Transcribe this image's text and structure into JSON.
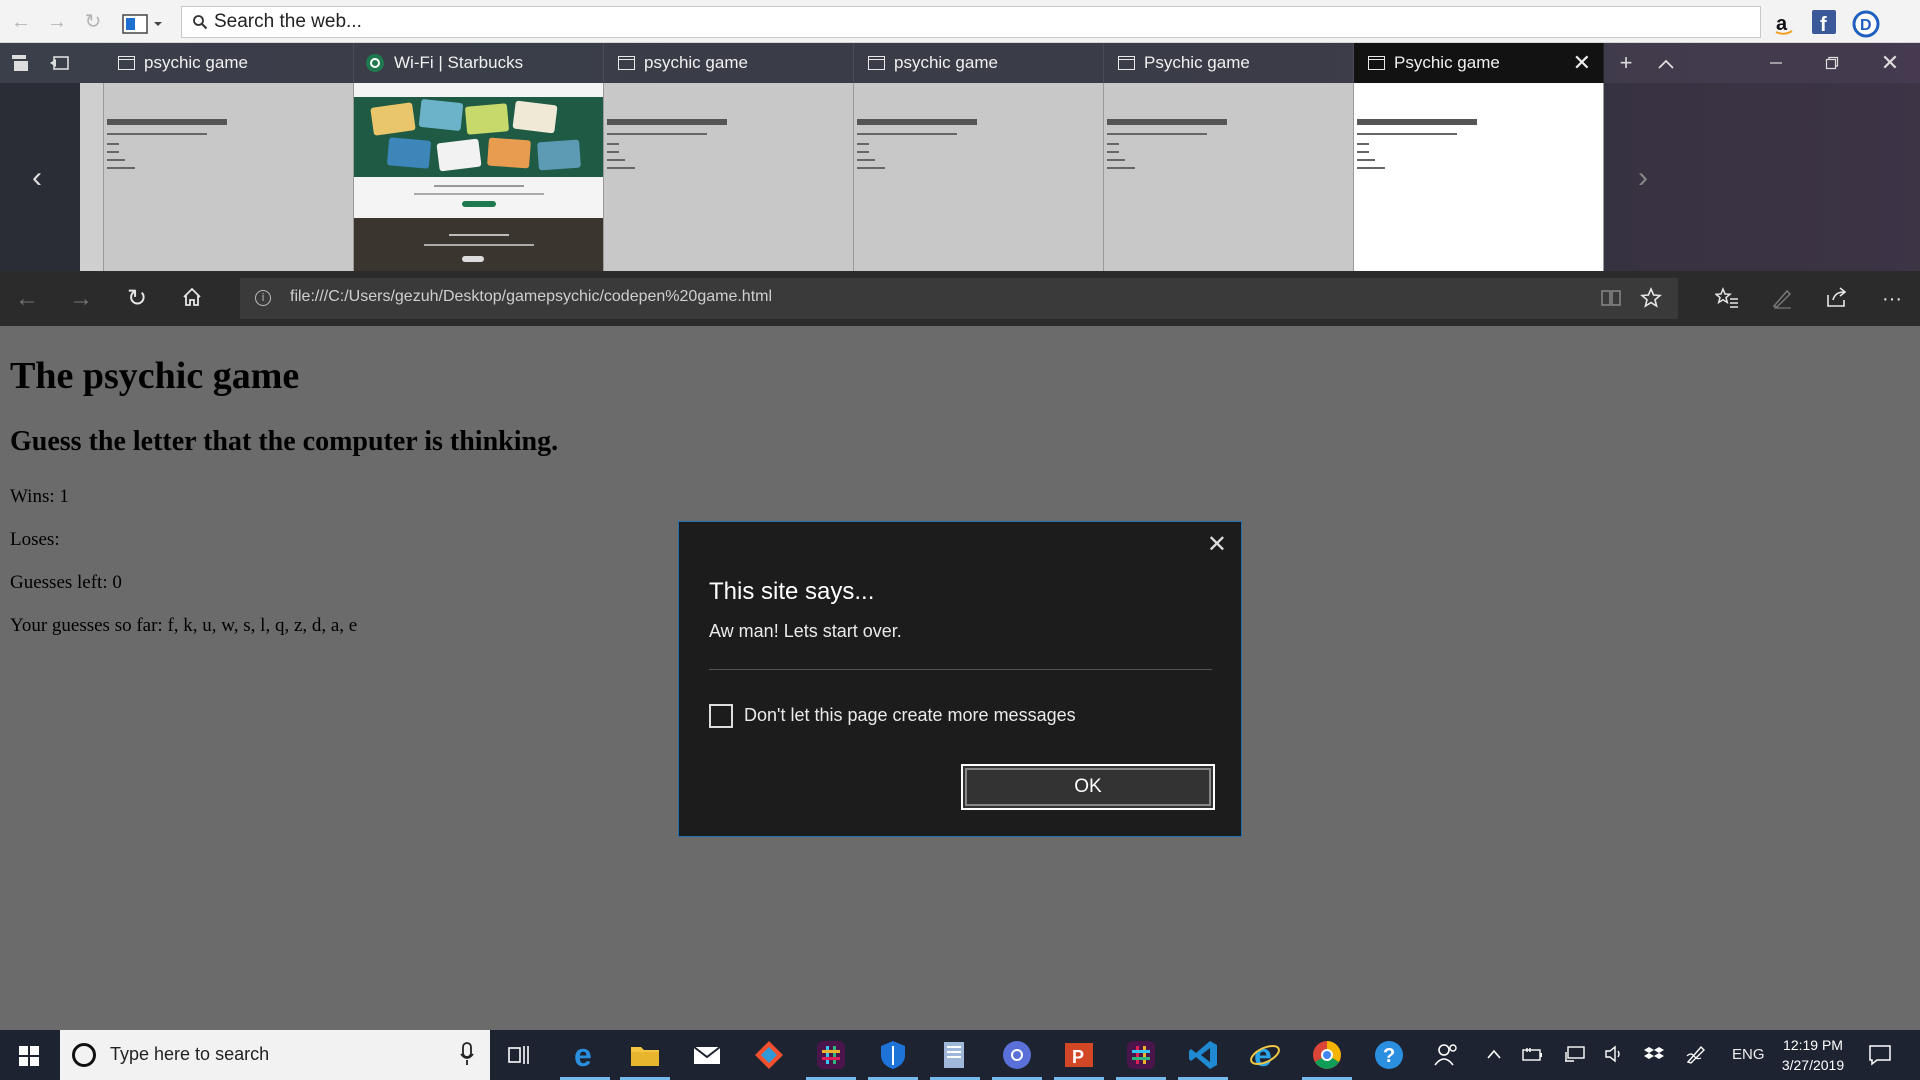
{
  "browser_toolbar": {
    "search_placeholder": "Search the web..."
  },
  "tabs": [
    {
      "label": "psychic game",
      "active": false,
      "icon": "page-icon"
    },
    {
      "label": "Wi-Fi | Starbucks",
      "active": false,
      "icon": "starbucks-icon"
    },
    {
      "label": "psychic game",
      "active": false,
      "icon": "page-icon"
    },
    {
      "label": "psychic game",
      "active": false,
      "icon": "page-icon"
    },
    {
      "label": "Psychic game",
      "active": false,
      "icon": "page-icon"
    },
    {
      "label": "Psychic game",
      "active": true,
      "icon": "page-icon"
    }
  ],
  "address_bar": {
    "url": "file:///C:/Users/gezuh/Desktop/gamepsychic/codepen%20game.html"
  },
  "page": {
    "title": "The psychic game",
    "subtitle": "Guess the letter that the computer is thinking.",
    "wins": "Wins: 1",
    "loses": "Loses:",
    "guesses_left": "Guesses left: 0",
    "guesses_so_far": "Your guesses so far: f, k, u, w, s, l, q, z, d, a, e"
  },
  "dialog": {
    "title": "This site says...",
    "message": "Aw man! Lets start over.",
    "checkbox_label": "Don't let this page create more messages",
    "checkbox_checked": false,
    "ok_label": "OK"
  },
  "taskbar": {
    "search_placeholder": "Type here to search",
    "language": "ENG",
    "time": "12:19 PM",
    "date": "3/27/2019"
  },
  "colors": {
    "dialog_border": "#1f6fb5",
    "page_overlay": "#6b6b6b",
    "taskbar": "#1d2330"
  }
}
